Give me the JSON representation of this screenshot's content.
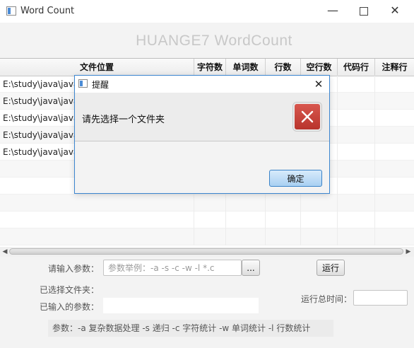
{
  "window": {
    "title": "Word Count",
    "minimize_glyph": "—",
    "close_glyph": "✕"
  },
  "app": {
    "heading": "HUANGE7 WordCount"
  },
  "table": {
    "columns": [
      "文件位置",
      "字符数",
      "单词数",
      "行数",
      "空行数",
      "代码行",
      "注释行"
    ],
    "rows": [
      {
        "path": "E:\\study\\java\\java"
      },
      {
        "path": "E:\\study\\java\\java"
      },
      {
        "path": "E:\\study\\java\\java"
      },
      {
        "path": "E:\\study\\java\\java"
      },
      {
        "path": "E:\\study\\java\\java"
      }
    ]
  },
  "scrollbar": {
    "left_glyph": "◀",
    "right_glyph": "▶"
  },
  "form": {
    "param_label": "请输入参数：",
    "param_placeholder": "参数举例：-a -s -c -w -l *.c",
    "browse_label": "...",
    "run_label": "运行",
    "selected_folder_label": "已选择文件夹：",
    "entered_params_label": "已输入的参数：",
    "total_time_label": "运行总时间：",
    "help_text": "参数：-a 复杂数据处理   -s 递归   -c 字符统计   -w  单词统计   -l 行数统计"
  },
  "dialog": {
    "title": "提醒",
    "close_glyph": "✕",
    "message": "请先选择一个文件夹",
    "ok_label": "确定",
    "icon": "error-icon",
    "icon_color": "#c8423a"
  }
}
